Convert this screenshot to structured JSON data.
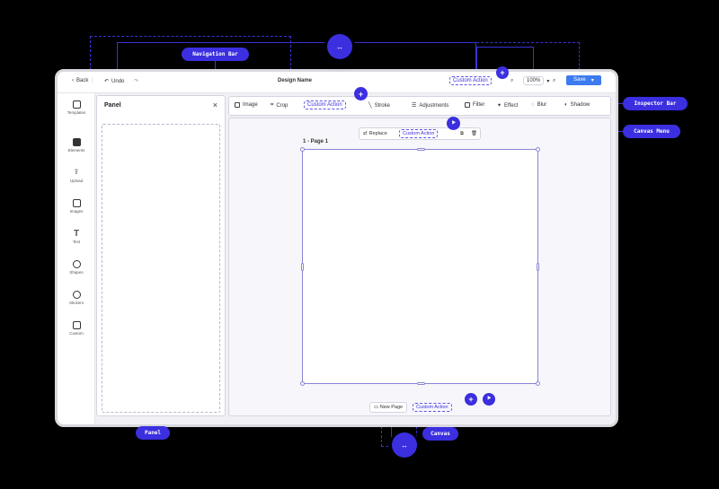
{
  "callouts": {
    "navigation_bar": "Navigation Bar",
    "inspector_bar": "Inspector Bar",
    "canvas_menu": "Canvas Menu",
    "panel": "Panel",
    "canvas": "Canvas"
  },
  "dots": {
    "plus": "+",
    "cursor": "⯈",
    "arrows": "↔"
  },
  "navbar": {
    "back_label": "Back",
    "undo_label": "Undo",
    "redo_icon": "↷",
    "title": "Design Name",
    "custom_action": "Custom Action",
    "zoom": "100%",
    "save_label": "Save"
  },
  "rail": {
    "items": [
      "Templates",
      "Elements",
      "Upload",
      "Images",
      "Text",
      "Shapes",
      "Stickers",
      "Custom"
    ]
  },
  "panel": {
    "title": "Panel",
    "close": "×"
  },
  "inspector": {
    "image": "Image",
    "crop": "Crop",
    "custom_action": "Custom Action",
    "stroke": "Stroke",
    "adjustments": "Adjustments",
    "filter": "Filter",
    "effect": "Effect",
    "blur": "Blur",
    "shadow": "Shadow"
  },
  "canvas_menu": {
    "replace": "Replace",
    "custom_action": "Custom Action"
  },
  "page": {
    "label": "1 - Page 1"
  },
  "page_bar": {
    "new_page": "New Page",
    "custom_action": "Custom Action"
  },
  "colors": {
    "accent": "#3b2fe0",
    "save": "#3d7bf0",
    "background": "#000000"
  }
}
